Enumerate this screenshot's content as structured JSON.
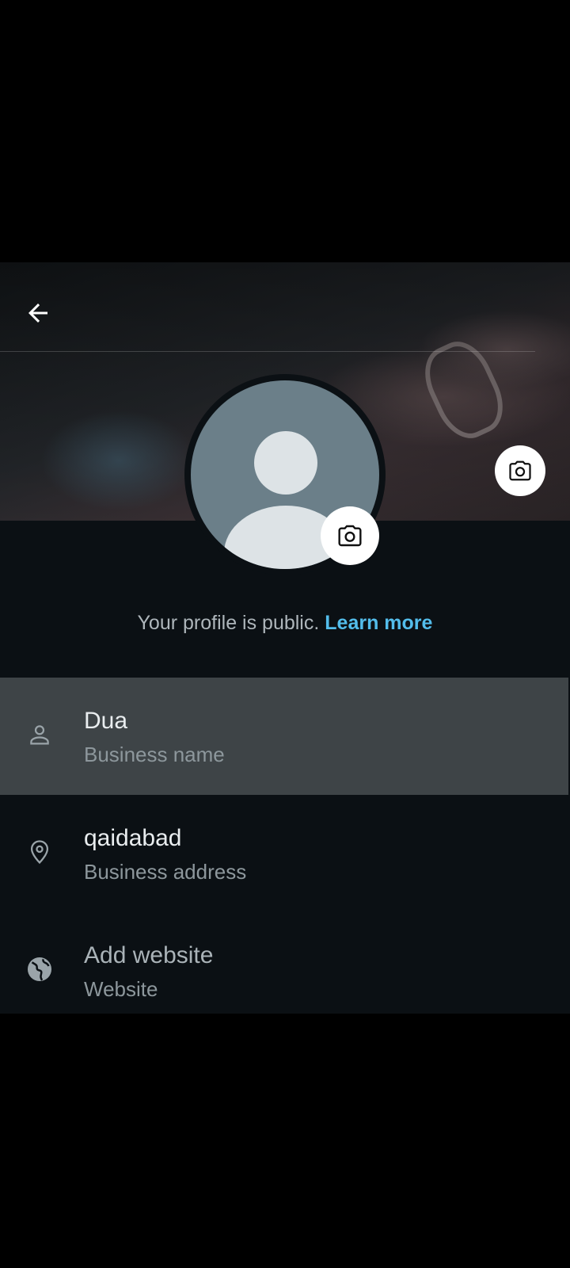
{
  "colors": {
    "background": "#0b1014",
    "highlight_row": "#3e4447",
    "link": "#53bdeb",
    "avatar_bg": "#6b7f89"
  },
  "header": {
    "back_icon": "arrow-left-icon"
  },
  "cover": {
    "camera_icon": "camera-icon"
  },
  "profile": {
    "avatar_icon": "default-person-avatar",
    "camera_icon": "camera-icon",
    "public_note": "Your profile is public.",
    "learn_more": "Learn more"
  },
  "fields": [
    {
      "icon": "person-icon",
      "value": "Dua",
      "label": "Business name"
    },
    {
      "icon": "location-pin-icon",
      "value": "qaidabad",
      "label": "Business address"
    },
    {
      "icon": "globe-icon",
      "value": "Add website",
      "label": "Website"
    }
  ]
}
